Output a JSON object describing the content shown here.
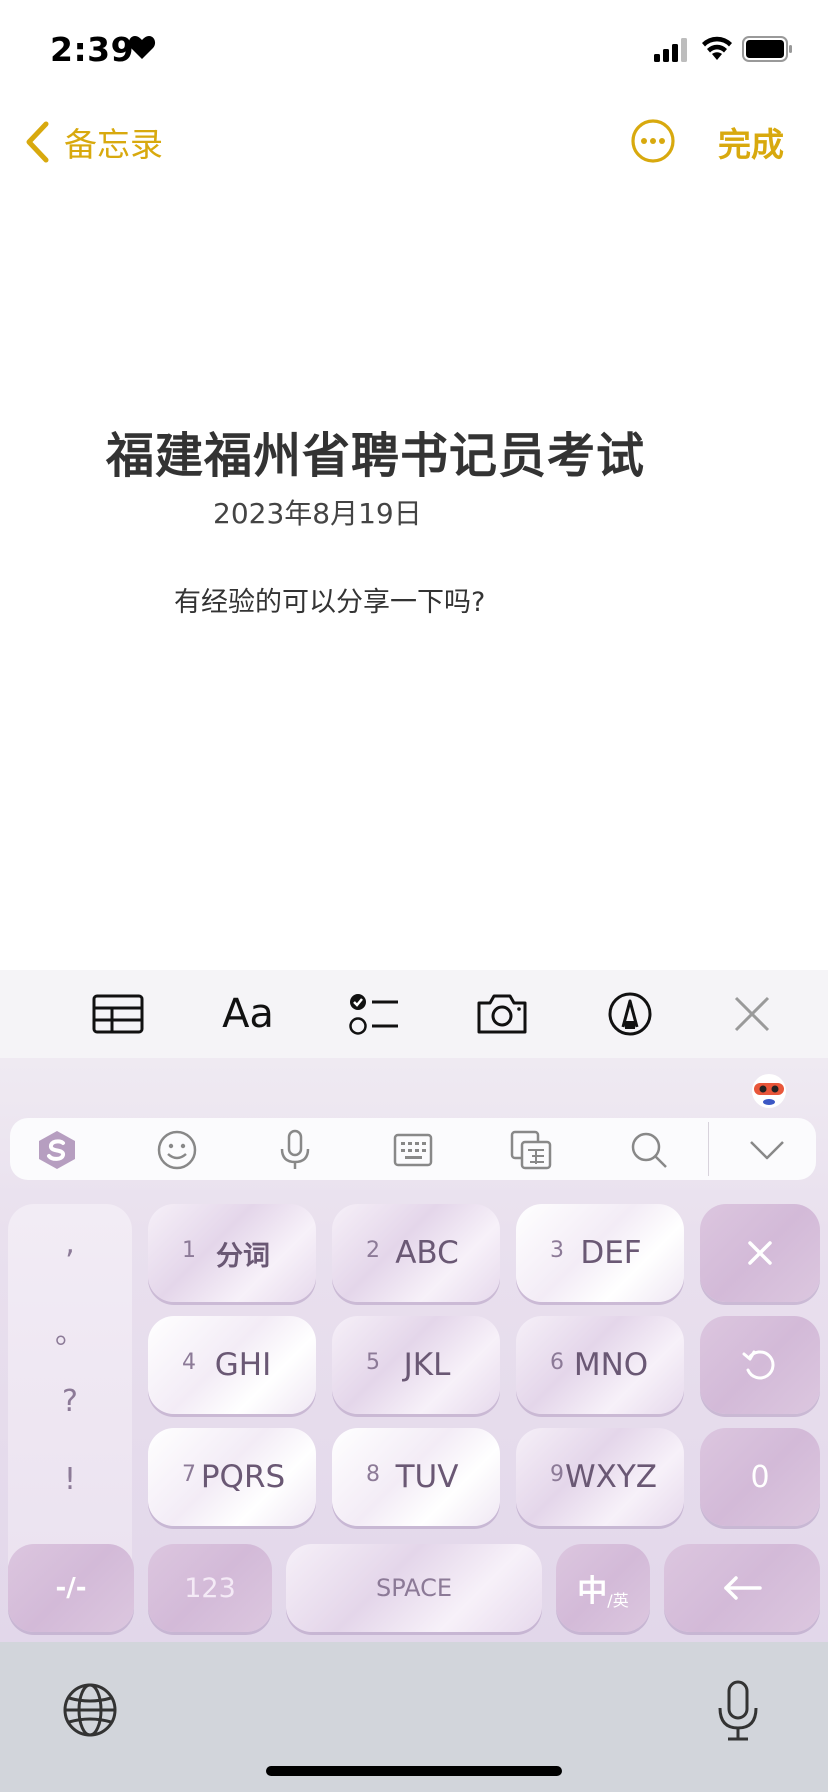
{
  "status_bar": {
    "time": "2:39"
  },
  "nav": {
    "back_label": "备忘录",
    "done_label": "完成"
  },
  "note": {
    "title": "福建福州省聘书记员考试",
    "date": "2023年8月19日",
    "body": "有经验的可以分享一下吗?"
  },
  "format_toolbar": {
    "text_format_label": "Aa"
  },
  "keyboard": {
    "punctuation": [
      ",",
      "。",
      "?",
      "!"
    ],
    "keys": [
      {
        "number": "1",
        "letters": "分词"
      },
      {
        "number": "2",
        "letters": "ABC"
      },
      {
        "number": "3",
        "letters": "DEF"
      },
      {
        "number": "4",
        "letters": "GHI"
      },
      {
        "number": "5",
        "letters": "JKL"
      },
      {
        "number": "6",
        "letters": "MNO"
      },
      {
        "number": "7",
        "letters": "PQRS"
      },
      {
        "number": "8",
        "letters": "TUV"
      },
      {
        "number": "9",
        "letters": "WXYZ"
      }
    ],
    "right_keys": {
      "zero": "0"
    },
    "bottom_row": {
      "symbols": "-/-",
      "numbers": "123",
      "space": "SPACE",
      "lang_main": "中",
      "lang_sub": "/英"
    }
  },
  "colors": {
    "accent": "#d8a90e",
    "keyboard_dark": "#d3bad8"
  }
}
